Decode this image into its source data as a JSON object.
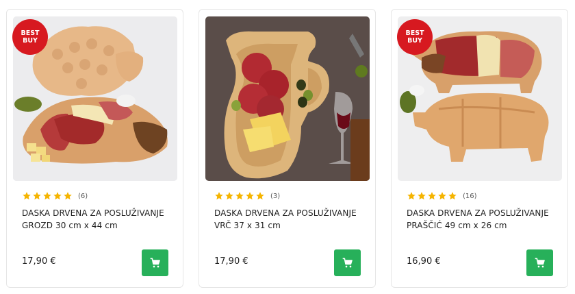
{
  "colors": {
    "badge": "#d71920",
    "star": "#f5b400",
    "cart_button": "#27b05a"
  },
  "products": [
    {
      "badge": "BEST\nBUY",
      "rating": 5,
      "review_count": "(6)",
      "title_line1": "DASKA DRVENA ZA POSLUŽIVANJE",
      "title_line2": "GROZD 30 cm x 44 cm",
      "price": "17,90 €",
      "cart_icon": "cart-icon"
    },
    {
      "badge": "",
      "rating": 5,
      "review_count": "(3)",
      "title_line1": "DASKA DRVENA ZA POSLUŽIVANJE",
      "title_line2": "VRČ 37 x 31 cm",
      "price": "17,90 €",
      "cart_icon": "cart-icon"
    },
    {
      "badge": "BEST\nBUY",
      "rating": 5,
      "review_count": "(16)",
      "title_line1": "DASKA DRVENA ZA POSLUŽIVANJE",
      "title_line2": "PRAŠČIĆ 49 cm x 26 cm",
      "price": "16,90 €",
      "cart_icon": "cart-icon"
    }
  ]
}
